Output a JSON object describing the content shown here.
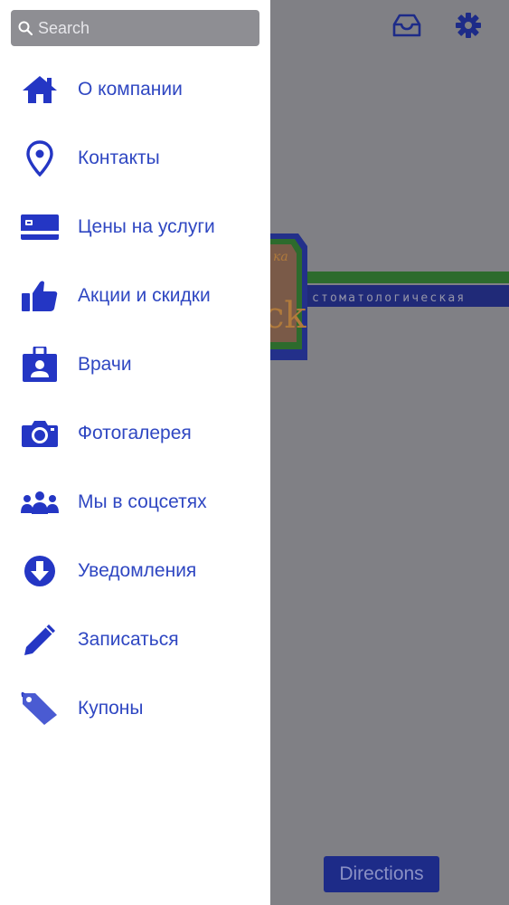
{
  "search": {
    "placeholder": "Search"
  },
  "menu": {
    "items": [
      {
        "label": "О компании",
        "icon": "home-icon"
      },
      {
        "label": "Контакты",
        "icon": "map-pin-icon"
      },
      {
        "label": "Цены на услуги",
        "icon": "credit-card-icon"
      },
      {
        "label": "Акции и скидки",
        "icon": "thumbs-up-icon"
      },
      {
        "label": "Врачи",
        "icon": "id-badge-icon"
      },
      {
        "label": "Фотогалерея",
        "icon": "camera-icon"
      },
      {
        "label": "Мы в соцсетях",
        "icon": "people-icon"
      },
      {
        "label": "Уведомления",
        "icon": "arrow-down-circle-icon"
      },
      {
        "label": "Записаться",
        "icon": "pencil-icon"
      },
      {
        "label": "Купоны",
        "icon": "tag-icon"
      }
    ]
  },
  "background": {
    "logo_text": "стоматологическая",
    "directions_label": "Directions"
  },
  "colors": {
    "accent": "#2f47c2",
    "icon": "#2436c4",
    "overlay": "#808085",
    "button": "#1d2b88"
  }
}
